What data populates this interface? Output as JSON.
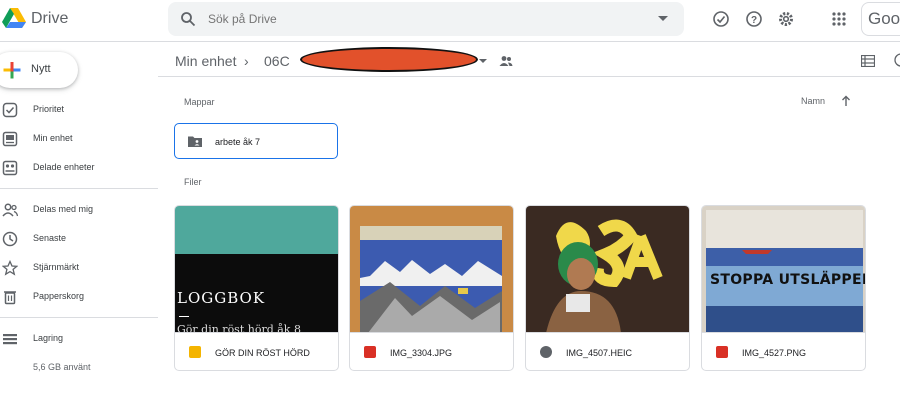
{
  "app": {
    "name": "Drive"
  },
  "search": {
    "placeholder": "Sök på Drive"
  },
  "header": {
    "google_chip": "Goo"
  },
  "sidebar": {
    "new_label": "Nytt",
    "items": [
      {
        "label": "Prioritet",
        "icon": "priority-check-icon"
      },
      {
        "label": "Min enhet",
        "icon": "my-drive-icon"
      },
      {
        "label": "Delade enheter",
        "icon": "shared-drives-icon"
      },
      {
        "label": "Delas med mig",
        "icon": "shared-with-me-icon"
      },
      {
        "label": "Senaste",
        "icon": "clock-icon"
      },
      {
        "label": "Stjärnmärkt",
        "icon": "star-icon"
      },
      {
        "label": "Papperskorg",
        "icon": "trash-icon"
      },
      {
        "label": "Lagring",
        "icon": "storage-icon"
      }
    ],
    "storage_used": "5,6 GB använt"
  },
  "breadcrumb": {
    "root": "Min enhet",
    "folder": "06C"
  },
  "sections": {
    "folders": "Mappar",
    "files": "Filer",
    "sort": "Namn"
  },
  "folders": [
    {
      "name": "arbete åk 7"
    }
  ],
  "files": [
    {
      "name": "GÖR DIN RÖST HÖRD",
      "type": "slides",
      "icon_color": "#f4b400",
      "thumb_title": "LOGGBOK",
      "thumb_subtitle": "Gör din röst hörd åk 8"
    },
    {
      "name": "IMG_3304.JPG",
      "type": "image",
      "icon_color": "#d93025"
    },
    {
      "name": "IMG_4507.HEIC",
      "type": "heic",
      "icon_color": "#5f6368"
    },
    {
      "name": "IMG_4527.PNG",
      "type": "image",
      "icon_color": "#d93025",
      "thumb_text": "STOPPA UTSLÄPPEN"
    }
  ],
  "colors": {
    "accent": "#1a73e8",
    "redaction": "#e2512b",
    "teal": "#4fa89c"
  }
}
